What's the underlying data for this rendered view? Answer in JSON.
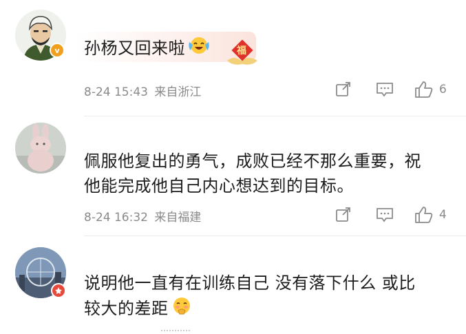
{
  "comments": [
    {
      "text": "孙杨又回来啦",
      "time": "8-24 15:43",
      "location": "来自浙江",
      "likes": "6",
      "avatar_icon": "cartoon-avatar-icon",
      "badge": "v"
    },
    {
      "text_line1": "佩服他复出的勇气，成败已经不那么重要，祝",
      "text_line2": "他能完成他自己内心想达到的目标。",
      "time": "8-24 16:32",
      "location": "来自福建",
      "likes": "4",
      "avatar_icon": "plush-rabbit-avatar-icon"
    },
    {
      "text_line1": "说明他一直有在训练自己 没有落下什么 或比",
      "text_line2": "较大的差距",
      "avatar_icon": "city-photo-avatar-icon"
    }
  ],
  "badge_fu": "福",
  "colors": {
    "vip_badge": "#f0a01e",
    "red_badge": "#e64a3c",
    "meta": "#8a8a8a"
  }
}
